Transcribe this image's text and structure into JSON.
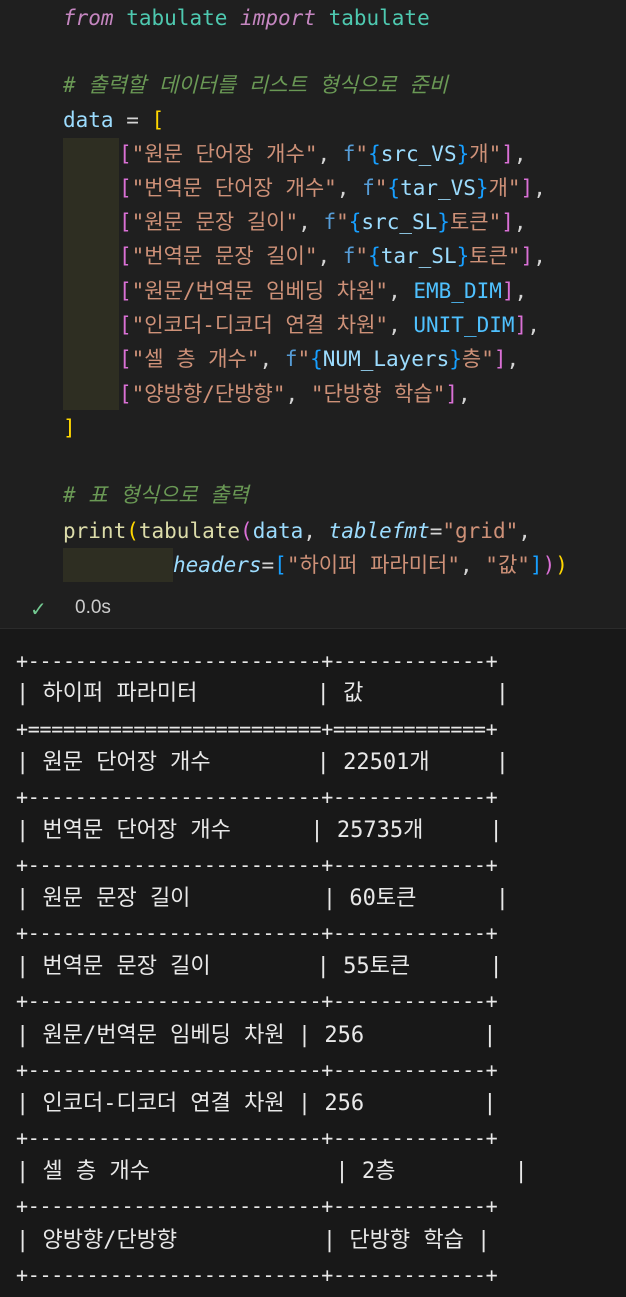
{
  "code": {
    "import": {
      "from": "from",
      "module": "tabulate",
      "import": "import",
      "name": "tabulate"
    },
    "comment1": "# 출력할 데이터를 리스트 형식으로 준비",
    "data_decl": {
      "var": "data",
      "eq": " = ",
      "open": "["
    },
    "rows": [
      {
        "text": "\"원문 단어장 개수\"",
        "f": "f\"",
        "expr": "src_VS",
        "suffix": "개\""
      },
      {
        "text": "\"번역문 단어장 개수\"",
        "f": "f\"",
        "expr": "tar_VS",
        "suffix": "개\""
      },
      {
        "text": "\"원문 문장 길이\"",
        "f": "f\"",
        "expr": "src_SL",
        "suffix": "토큰\""
      },
      {
        "text": "\"번역문 문장 길이\"",
        "f": "f\"",
        "expr": "tar_SL",
        "suffix": "토큰\""
      },
      {
        "text": "\"원문/번역문 임베딩 차원\"",
        "const": "EMB_DIM"
      },
      {
        "text": "\"인코더-디코더 연결 차원\"",
        "const": "UNIT_DIM"
      },
      {
        "text": "\"셀 층 개수\"",
        "f": "f\"",
        "expr": "NUM_Layers",
        "suffix": "층\""
      },
      {
        "text": "\"양방향/단방향\"",
        "str2": "\"단방향 학습\""
      }
    ],
    "close": "]",
    "comment2": "# 표 형식으로 출력",
    "print_line": {
      "fn": "print",
      "fn2": "tabulate",
      "arg": "data",
      "kw": "tablefmt",
      "val": "\"grid\""
    },
    "headers_line": {
      "kw": "headers",
      "h1": "\"하이퍼 파라미터\"",
      "h2": "\"값\""
    }
  },
  "status": {
    "check_icon": "check-icon",
    "time": "0.0s"
  },
  "output": {
    "border": "+-------------------------+-------------+",
    "header_sep": "+=========================+=============+",
    "header": "| 하이퍼 파라미터         | 값          |",
    "rows": [
      "| 원문 단어장 개수        | 22501개     |",
      "| 번역문 단어장 개수      | 25735개     |",
      "| 원문 문장 길이          | 60토큰      |",
      "| 번역문 문장 길이        | 55토큰      |",
      "| 원문/번역문 임베딩 차원 | 256         |",
      "| 인코더-디코더 연결 차원 | 256         |",
      "| 셀 층 개수              | 2층         |",
      "| 양방향/단방향           | 단방향 학습 |"
    ]
  }
}
